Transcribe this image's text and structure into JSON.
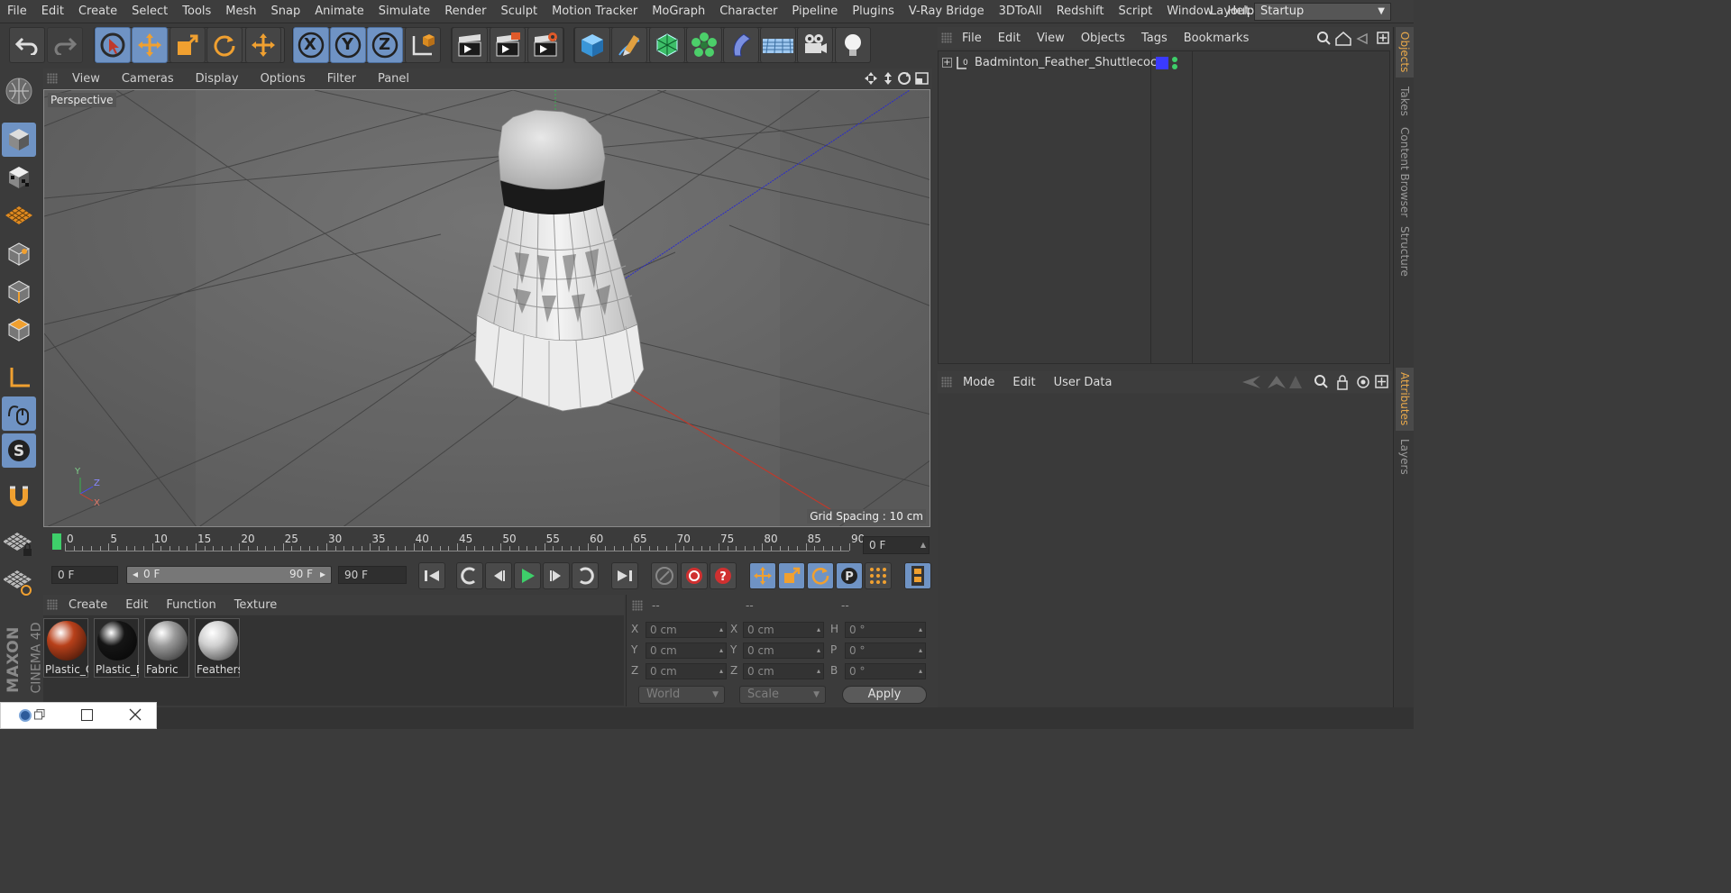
{
  "menubar": {
    "items": [
      "File",
      "Edit",
      "Create",
      "Select",
      "Tools",
      "Mesh",
      "Snap",
      "Animate",
      "Simulate",
      "Render",
      "Sculpt",
      "Motion Tracker",
      "MoGraph",
      "Character",
      "Pipeline",
      "Plugins",
      "V-Ray Bridge",
      "3DToAll",
      "Redshift",
      "Script",
      "Window",
      "Help"
    ],
    "layout_label": "Layout:",
    "layout_value": "Startup"
  },
  "toolbar": {
    "axis_x": "X",
    "axis_y": "Y",
    "axis_z": "Z"
  },
  "viewport": {
    "menu": [
      "View",
      "Cameras",
      "Display",
      "Options",
      "Filter",
      "Panel"
    ],
    "camera_label": "Perspective",
    "grid_spacing": "Grid Spacing : 10 cm",
    "axis_y": "Y",
    "axis_z": "Z",
    "axis_x": "X"
  },
  "timeline": {
    "labels": [
      "0",
      "5",
      "10",
      "15",
      "20",
      "25",
      "30",
      "35",
      "40",
      "45",
      "50",
      "55",
      "60",
      "65",
      "70",
      "75",
      "80",
      "85",
      "90"
    ],
    "current_frame": "0 F",
    "start_field": "0 F",
    "range_start": "0 F",
    "range_end": "90 F",
    "end_field": "90 F"
  },
  "materials": {
    "menu": [
      "Create",
      "Edit",
      "Function",
      "Texture"
    ],
    "items": [
      {
        "name": "Plastic_O",
        "color": "#b8401a"
      },
      {
        "name": "Plastic_B",
        "color": "#151515"
      },
      {
        "name": "Fabric",
        "color": "#9a9a9a"
      },
      {
        "name": "Feathers",
        "color": "#d0d0d0"
      }
    ]
  },
  "coordinates": {
    "headers": [
      "--",
      "--",
      "--"
    ],
    "pos": [
      {
        "axis": "X",
        "value": "0 cm"
      },
      {
        "axis": "Y",
        "value": "0 cm"
      },
      {
        "axis": "Z",
        "value": "0 cm"
      }
    ],
    "size": [
      {
        "axis": "X",
        "value": "0 cm"
      },
      {
        "axis": "Y",
        "value": "0 cm"
      },
      {
        "axis": "Z",
        "value": "0 cm"
      }
    ],
    "rot": [
      {
        "axis": "H",
        "value": "0 °"
      },
      {
        "axis": "P",
        "value": "0 °"
      },
      {
        "axis": "B",
        "value": "0 °"
      }
    ],
    "mode_world": "World",
    "mode_scale": "Scale",
    "apply": "Apply"
  },
  "objects": {
    "menu": [
      "File",
      "Edit",
      "View",
      "Objects",
      "Tags",
      "Bookmarks"
    ],
    "tree": [
      {
        "name": "Badminton_Feather_Shuttlecock",
        "layer_color": "#3a3aff"
      }
    ]
  },
  "attributes": {
    "menu": [
      "Mode",
      "Edit",
      "User Data"
    ]
  },
  "side_tabs": [
    "Objects",
    "Takes",
    "Content Browser",
    "Structure",
    "Attributes",
    "Layers"
  ],
  "brand": {
    "line1": "MAXON",
    "line2": "CINEMA 4D"
  },
  "colors": {
    "accent_blue": "#6f93c4",
    "tab_active": "#e9a94a"
  }
}
